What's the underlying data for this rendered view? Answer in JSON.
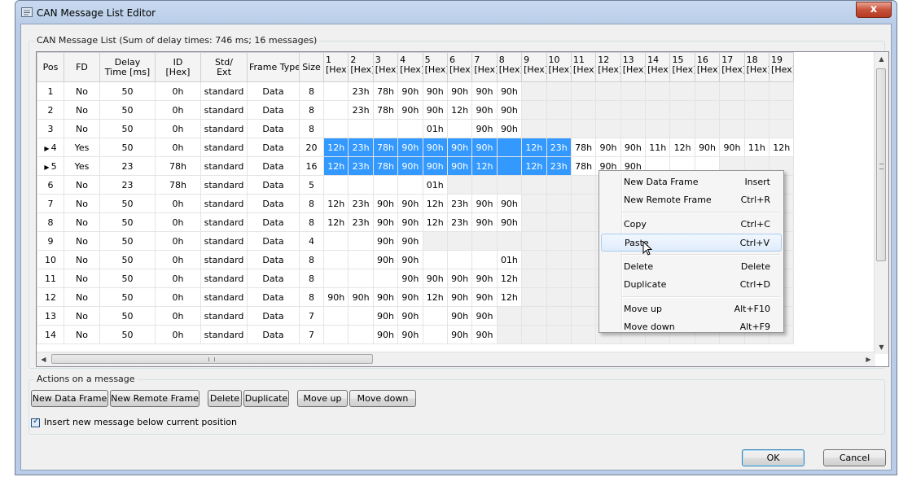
{
  "window": {
    "title": "CAN Message List Editor",
    "close_label": "x"
  },
  "list_group": {
    "title": "CAN Message List (Sum of delay times: 746 ms; 16 messages)"
  },
  "table": {
    "headers": [
      {
        "l1": "Pos",
        "l2": ""
      },
      {
        "l1": "FD",
        "l2": ""
      },
      {
        "l1": "Delay",
        "l2": "Time [ms]"
      },
      {
        "l1": "ID",
        "l2": "[Hex]"
      },
      {
        "l1": "Std/",
        "l2": "Ext"
      },
      {
        "l1": "Frame Type",
        "l2": ""
      },
      {
        "l1": "Size",
        "l2": ""
      },
      {
        "l1": "1",
        "l2": "[Hex]"
      },
      {
        "l1": "2",
        "l2": "[Hex]"
      },
      {
        "l1": "3",
        "l2": "[Hex]"
      },
      {
        "l1": "4",
        "l2": "[Hex]"
      },
      {
        "l1": "5",
        "l2": "[Hex]"
      },
      {
        "l1": "6",
        "l2": "[Hex]"
      },
      {
        "l1": "7",
        "l2": "[Hex]"
      },
      {
        "l1": "8",
        "l2": "[Hex]"
      },
      {
        "l1": "9",
        "l2": "[Hex]"
      },
      {
        "l1": "10",
        "l2": "[Hex]"
      },
      {
        "l1": "11",
        "l2": "[Hex]"
      },
      {
        "l1": "12",
        "l2": "[Hex]"
      },
      {
        "l1": "13",
        "l2": "[Hex]"
      },
      {
        "l1": "14",
        "l2": "[Hex]"
      },
      {
        "l1": "15",
        "l2": "[Hex]"
      },
      {
        "l1": "16",
        "l2": "[Hex]"
      },
      {
        "l1": "17",
        "l2": "[Hex]"
      },
      {
        "l1": "18",
        "l2": "[Hex]"
      },
      {
        "l1": "19",
        "l2": "[Hex]"
      }
    ],
    "selected_marker": "▶",
    "rows": [
      {
        "pos": "1",
        "fd": "No",
        "delay": "50",
        "id": "0h",
        "std": "standard",
        "type": "Data",
        "size": "8",
        "selected": false,
        "bytes": [
          "",
          "23h",
          "78h",
          "90h",
          "90h",
          "90h",
          "90h",
          "90h",
          "",
          "",
          "",
          "",
          "",
          "",
          "",
          "",
          "",
          "",
          ""
        ]
      },
      {
        "pos": "2",
        "fd": "No",
        "delay": "50",
        "id": "0h",
        "std": "standard",
        "type": "Data",
        "size": "8",
        "selected": false,
        "bytes": [
          "",
          "23h",
          "78h",
          "90h",
          "90h",
          "12h",
          "90h",
          "90h",
          "",
          "",
          "",
          "",
          "",
          "",
          "",
          "",
          "",
          "",
          ""
        ]
      },
      {
        "pos": "3",
        "fd": "No",
        "delay": "50",
        "id": "0h",
        "std": "standard",
        "type": "Data",
        "size": "8",
        "selected": false,
        "bytes": [
          "",
          "",
          "",
          "",
          "01h",
          "",
          "90h",
          "90h",
          "",
          "",
          "",
          "",
          "",
          "",
          "",
          "",
          "",
          "",
          ""
        ]
      },
      {
        "pos": "4",
        "fd": "Yes",
        "delay": "50",
        "id": "0h",
        "std": "standard",
        "type": "Data",
        "size": "20",
        "selected": true,
        "bytes": [
          "12h",
          "23h",
          "78h",
          "90h",
          "90h",
          "90h",
          "90h",
          "",
          "12h",
          "23h",
          "78h",
          "90h",
          "90h",
          "11h",
          "12h",
          "90h",
          "90h",
          "11h",
          "12h"
        ]
      },
      {
        "pos": "5",
        "fd": "Yes",
        "delay": "23",
        "id": "78h",
        "std": "standard",
        "type": "Data",
        "size": "16",
        "selected": true,
        "bytes": [
          "12h",
          "23h",
          "78h",
          "90h",
          "90h",
          "90h",
          "12h",
          "",
          "12h",
          "23h",
          "78h",
          "90h",
          "90h",
          "",
          "",
          "",
          "",
          "",
          ""
        ]
      },
      {
        "pos": "6",
        "fd": "No",
        "delay": "23",
        "id": "78h",
        "std": "standard",
        "type": "Data",
        "size": "5",
        "selected": false,
        "bytes": [
          "",
          "",
          "",
          "",
          "01h",
          "",
          "",
          "",
          "",
          "",
          "",
          "",
          "",
          "",
          "",
          "",
          "",
          "",
          ""
        ]
      },
      {
        "pos": "7",
        "fd": "No",
        "delay": "50",
        "id": "0h",
        "std": "standard",
        "type": "Data",
        "size": "8",
        "selected": false,
        "bytes": [
          "12h",
          "23h",
          "90h",
          "90h",
          "12h",
          "23h",
          "90h",
          "90h",
          "",
          "",
          "",
          "",
          "",
          "",
          "",
          "",
          "",
          "",
          ""
        ]
      },
      {
        "pos": "8",
        "fd": "No",
        "delay": "50",
        "id": "0h",
        "std": "standard",
        "type": "Data",
        "size": "8",
        "selected": false,
        "bytes": [
          "12h",
          "23h",
          "90h",
          "90h",
          "12h",
          "23h",
          "90h",
          "90h",
          "",
          "",
          "",
          "",
          "",
          "",
          "",
          "",
          "",
          "",
          ""
        ]
      },
      {
        "pos": "9",
        "fd": "No",
        "delay": "50",
        "id": "0h",
        "std": "standard",
        "type": "Data",
        "size": "4",
        "selected": false,
        "bytes": [
          "",
          "",
          "90h",
          "90h",
          "",
          "",
          "",
          "",
          "",
          "",
          "",
          "",
          "",
          "",
          "",
          "",
          "",
          "",
          ""
        ]
      },
      {
        "pos": "10",
        "fd": "No",
        "delay": "50",
        "id": "0h",
        "std": "standard",
        "type": "Data",
        "size": "8",
        "selected": false,
        "bytes": [
          "",
          "",
          "90h",
          "90h",
          "",
          "",
          "",
          "01h",
          "",
          "",
          "",
          "",
          "",
          "",
          "",
          "",
          "",
          "",
          ""
        ]
      },
      {
        "pos": "11",
        "fd": "No",
        "delay": "50",
        "id": "0h",
        "std": "standard",
        "type": "Data",
        "size": "8",
        "selected": false,
        "bytes": [
          "",
          "",
          "",
          "90h",
          "90h",
          "90h",
          "90h",
          "12h",
          "",
          "",
          "",
          "",
          "",
          "",
          "",
          "",
          "",
          "",
          ""
        ]
      },
      {
        "pos": "12",
        "fd": "No",
        "delay": "50",
        "id": "0h",
        "std": "standard",
        "type": "Data",
        "size": "8",
        "selected": false,
        "bytes": [
          "90h",
          "90h",
          "90h",
          "90h",
          "12h",
          "90h",
          "90h",
          "12h",
          "",
          "",
          "",
          "",
          "",
          "",
          "",
          "",
          "",
          "",
          ""
        ]
      },
      {
        "pos": "13",
        "fd": "No",
        "delay": "50",
        "id": "0h",
        "std": "standard",
        "type": "Data",
        "size": "7",
        "selected": false,
        "bytes": [
          "",
          "",
          "90h",
          "90h",
          "",
          "90h",
          "90h",
          "",
          "",
          "",
          "",
          "",
          "",
          "",
          "",
          "",
          "",
          "",
          ""
        ]
      },
      {
        "pos": "14",
        "fd": "No",
        "delay": "50",
        "id": "0h",
        "std": "standard",
        "type": "Data",
        "size": "7",
        "selected": false,
        "bytes": [
          "",
          "",
          "90h",
          "90h",
          "",
          "90h",
          "90h",
          "",
          "",
          "",
          "",
          "",
          "",
          "",
          "",
          "",
          "",
          "",
          ""
        ]
      }
    ]
  },
  "context_menu": {
    "items": [
      {
        "label": "New Data Frame",
        "shortcut": "Insert",
        "hover": false,
        "sep_after": false
      },
      {
        "label": "New Remote Frame",
        "shortcut": "Ctrl+R",
        "hover": false,
        "sep_after": true
      },
      {
        "label": "Copy",
        "shortcut": "Ctrl+C",
        "hover": false,
        "sep_after": false
      },
      {
        "label": "Paste",
        "shortcut": "Ctrl+V",
        "hover": true,
        "sep_after": true
      },
      {
        "label": "Delete",
        "shortcut": "Delete",
        "hover": false,
        "sep_after": false
      },
      {
        "label": "Duplicate",
        "shortcut": "Ctrl+D",
        "hover": false,
        "sep_after": true
      },
      {
        "label": "Move up",
        "shortcut": "Alt+F10",
        "hover": false,
        "sep_after": false
      },
      {
        "label": "Move down",
        "shortcut": "Alt+F9",
        "hover": false,
        "sep_after": false
      }
    ]
  },
  "actions_group": {
    "title": "Actions on a message",
    "buttons": {
      "new_data": "New Data Frame",
      "new_remote": "New Remote Frame",
      "delete": "Delete",
      "duplicate": "Duplicate",
      "move_up": "Move up",
      "move_down": "Move down"
    },
    "insert_below": {
      "label": "Insert new message below current position",
      "checked": true
    }
  },
  "footer": {
    "ok": "OK",
    "cancel": "Cancel"
  },
  "scrollbar_glyphs": {
    "up": "▲",
    "down": "▼",
    "left": "◀",
    "right": "▶"
  }
}
